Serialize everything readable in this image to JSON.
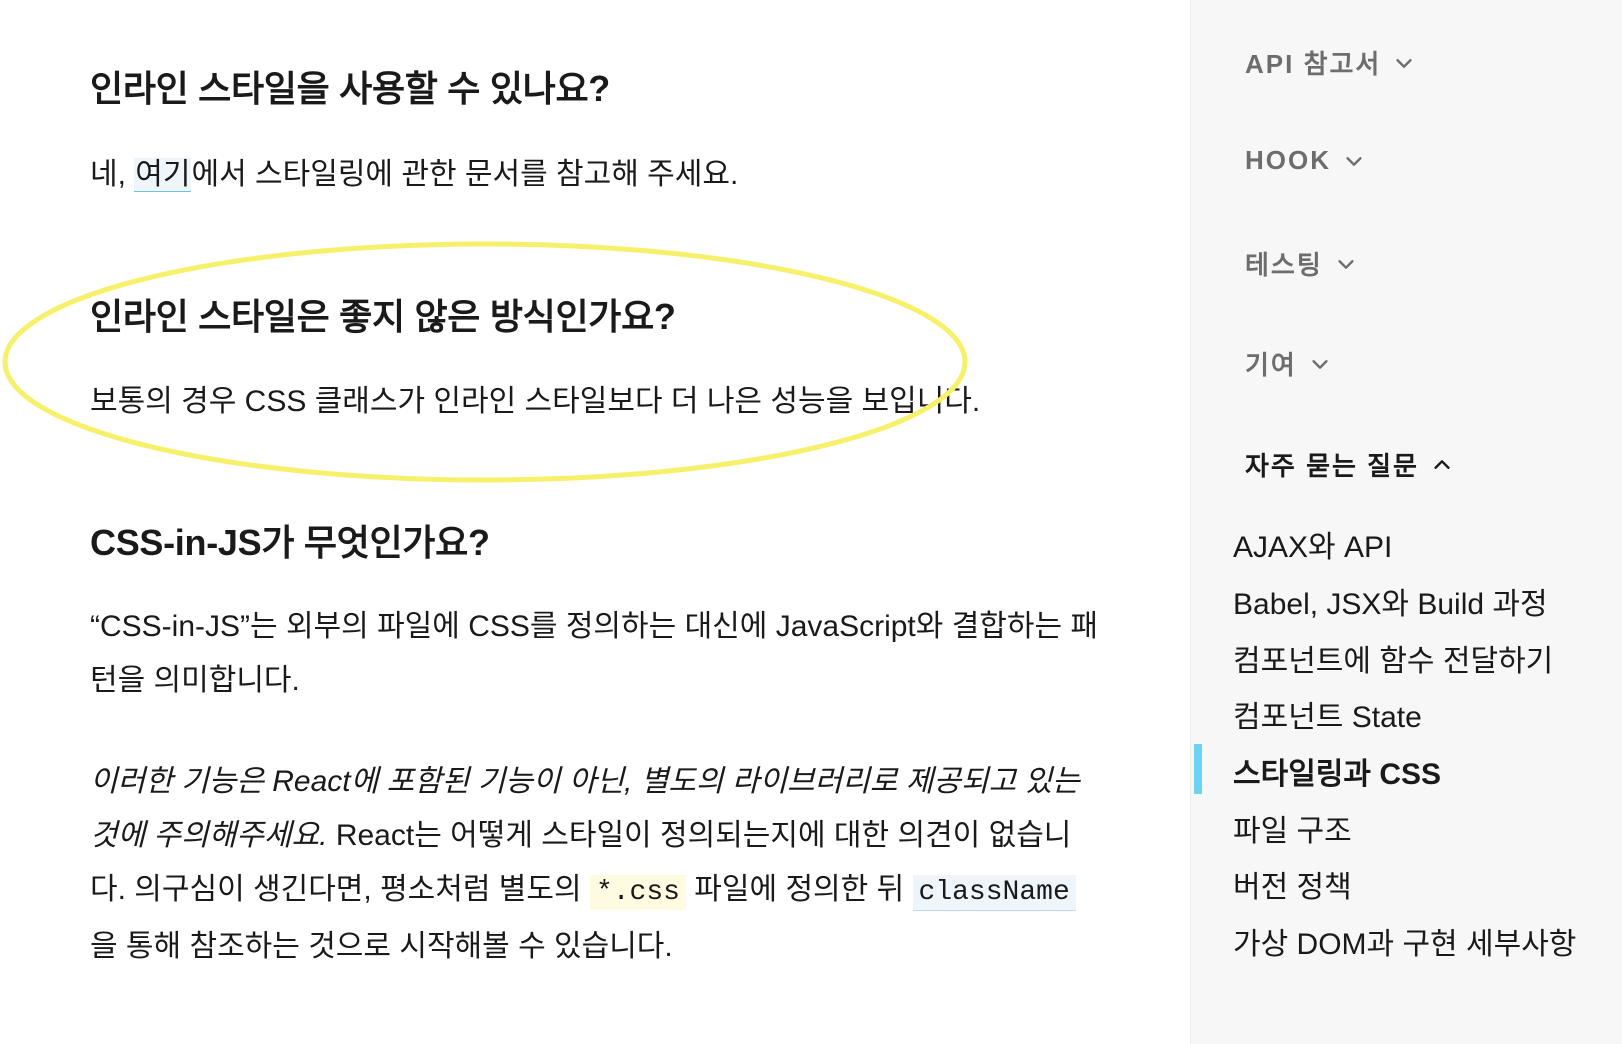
{
  "faq": {
    "q1": {
      "heading": "인라인 스타일을 사용할 수 있나요?",
      "pre": "네, ",
      "link": "여기",
      "post": "에서 스타일링에 관한 문서를 참고해 주세요."
    },
    "q2": {
      "heading": "인라인 스타일은 좋지 않은 방식인가요?",
      "body": "보통의 경우 CSS 클래스가 인라인 스타일보다 더 나은 성능을 보입니다."
    },
    "q3": {
      "heading": "CSS-in-JS가 무엇인가요?",
      "body1": "“CSS-in-JS”는 외부의 파일에 CSS를 정의하는 대신에 JavaScript와 결합하는 패턴을 의미합니다.",
      "italic": "이러한 기능은 React에 포함된 기능이 아닌, 별도의 라이브러리로 제공되고 있는 것에 주의해주세요.",
      "body2a": " React는 어떻게 스타일이 정의되는지에 대한 의견이 없습니다. 의구심이 생긴다면, 평소처럼 별도의 ",
      "code1": "*.css",
      "body2b": " 파일에 정의한 뒤 ",
      "code2": "className",
      "body2c": "을 통해 참조하는 것으로 시작해볼 수 있습니다."
    }
  },
  "sidebar": {
    "sections": [
      {
        "label": "API 참고서",
        "icon": "chevron-down-icon"
      },
      {
        "label": "HOOK",
        "icon": "chevron-down-icon"
      },
      {
        "label": "테스팅",
        "icon": "chevron-down-icon"
      },
      {
        "label": "기여",
        "icon": "chevron-down-icon"
      },
      {
        "label": "자주 묻는 질문",
        "icon": "chevron-up-icon"
      }
    ],
    "items": [
      "AJAX와 API",
      "Babel, JSX와 Build 과정",
      "컴포넌트에 함수 전달하기",
      "컴포넌트 State",
      "스타일링과 CSS",
      "파일 구조",
      "버전 정책",
      "가상 DOM과 구현 세부사항"
    ]
  },
  "colors": {
    "annotation": "#f7f06a",
    "active_indicator": "#6ad4f2",
    "sidebar_bg": "#f7f7f7"
  }
}
